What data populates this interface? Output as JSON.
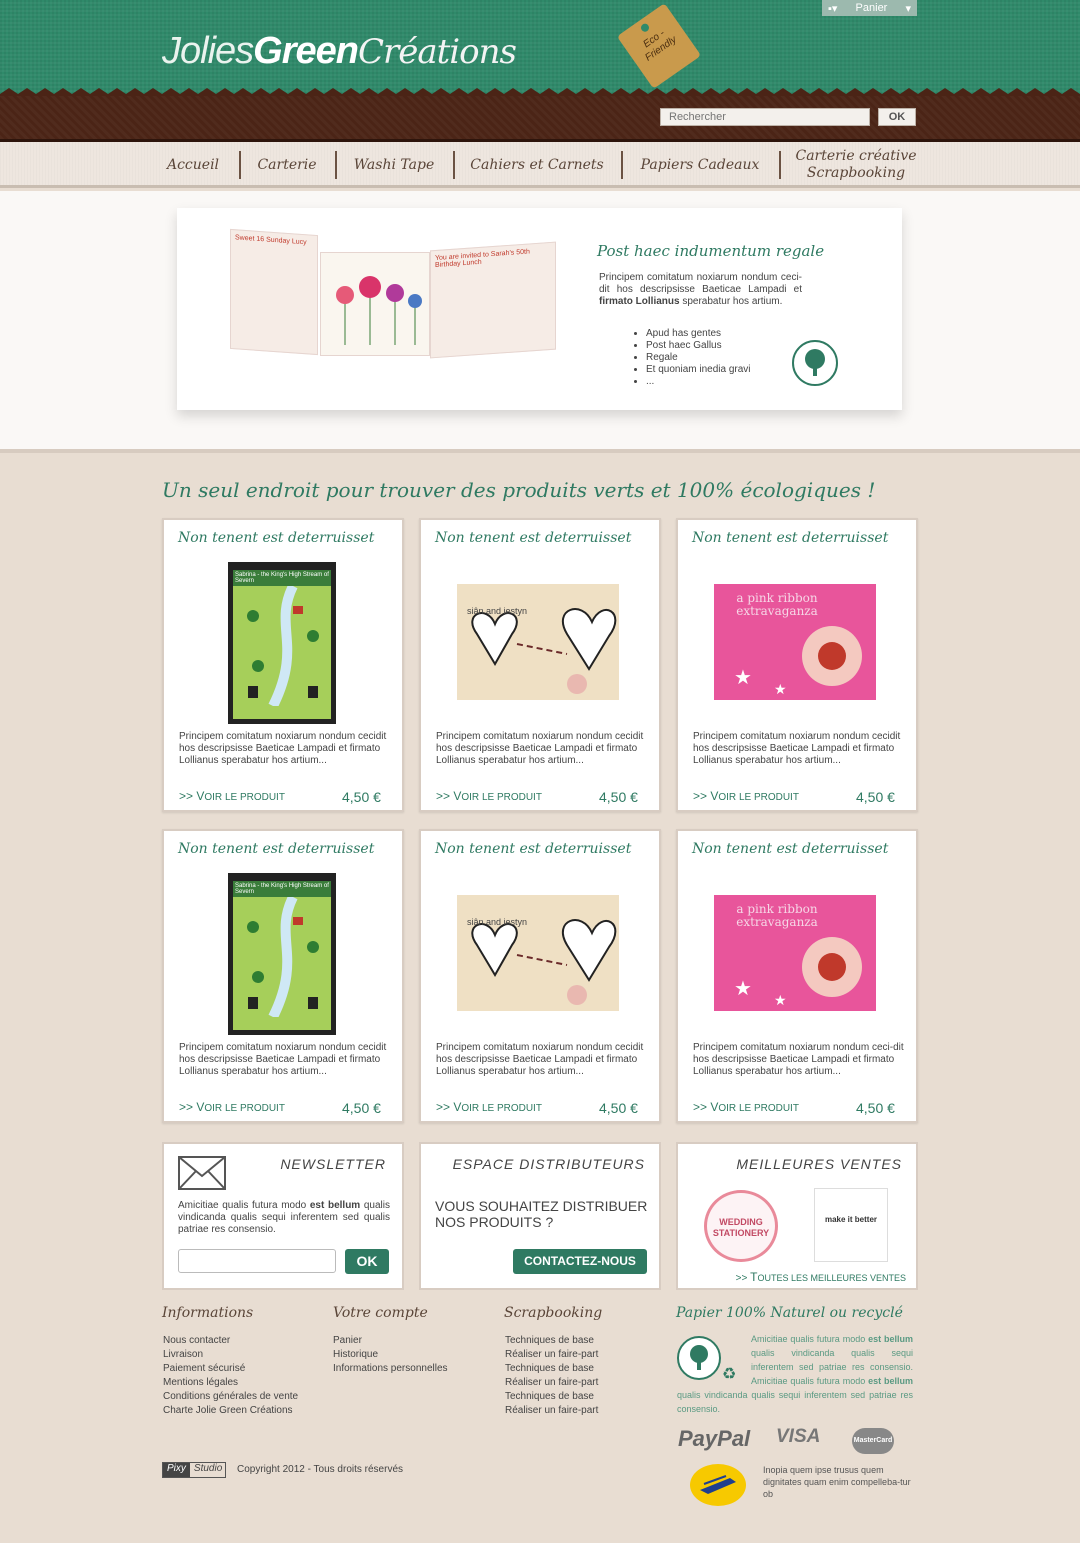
{
  "header": {
    "logo_part1": "Jolies",
    "logo_part2": "Green",
    "logo_part3": "Créations",
    "tag_text": "Eco - Friendly",
    "cart_label": "Panier",
    "search_placeholder": "Rechercher",
    "search_button": "OK"
  },
  "nav": [
    {
      "label": "Accueil"
    },
    {
      "label": "Carterie"
    },
    {
      "label": "Washi Tape"
    },
    {
      "label": "Cahiers et Carnets"
    },
    {
      "label": "Papiers Cadeaux"
    },
    {
      "label": "Carterie créative Scrapbooking"
    }
  ],
  "banner": {
    "title": "Post haec indumentum regale",
    "desc_pre": "Principem comitatum noxiarum nondum ceci-dit hos descripsisse Baeticae Lampadi et ",
    "desc_bold": "firmato Lollianus",
    "desc_post": " sperabatur hos artium.",
    "list": [
      "Apud has gentes",
      "Post haec Gallus",
      "Regale",
      "Et quoniam inedia gravi",
      "..."
    ],
    "card1_text": "Sweet 16 Sunday Lucy",
    "card2_text": "You are invited to Sarah's 50th Birthday Lunch"
  },
  "main": {
    "headline": "Un seul endroit pour trouver des produits verts et 100% écologiques !",
    "link_prefix": ">> ",
    "link_big": "V",
    "link_rest1": "OIR ",
    "link_big2": "LE PRODUIT",
    "products": [
      {
        "title": "Non tenent est deterruisset",
        "desc": "Principem comitatum noxiarum nondum cecidit hos descripsisse Baeticae Lampadi et firmato Lollianus sperabatur hos artium...",
        "price": "4,50 €",
        "image": "map-card",
        "img_text": "Sabrina - the King's High Stream of Severn"
      },
      {
        "title": "Non tenent est deterruisset",
        "desc": "Principem comitatum noxiarum nondum cecidit hos descripsisse Baeticae Lampadi et firmato Lollianus sperabatur hos artium...",
        "price": "4,50 €",
        "image": "hearts-card",
        "img_text": "siân and iestyn"
      },
      {
        "title": "Non tenent est deterruisset",
        "desc": "Principem comitatum noxiarum nondum cecidit hos descripsisse Baeticae Lampadi et firmato Lollianus sperabatur hos artium...",
        "price": "4,50 €",
        "image": "pink-card",
        "img_text": "a pink ribbon extravaganza"
      },
      {
        "title": "Non tenent est deterruisset",
        "desc": "Principem comitatum noxiarum nondum cecidit hos descripsisse Baeticae Lampadi et firmato Lollianus sperabatur hos artium...",
        "price": "4,50 €",
        "image": "map-card",
        "img_text": "Sabrina - the King's High Stream of Severn"
      },
      {
        "title": "Non tenent est deterruisset",
        "desc": "Principem comitatum noxiarum nondum cecidit hos descripsisse Baeticae Lampadi et firmato Lollianus sperabatur hos artium...",
        "price": "4,50 €",
        "image": "hearts-card",
        "img_text": "siân and iestyn"
      },
      {
        "title": "Non tenent est deterruisset",
        "desc": "Principem comitatum noxiarum nondum ceci-dit hos descripsisse Baeticae Lampadi et firmato Lollianus sperabatur hos artium...",
        "price": "4,50 €",
        "image": "pink-card",
        "img_text": "a pink ribbon extravaganza"
      }
    ]
  },
  "newsletter": {
    "title": "NEWSLETTER",
    "text_pre": "Amicitiae qualis futura modo ",
    "text_bold": "est bellum",
    "text_post": " qualis vindicanda qualis sequi inferentem sed qualis patriae res consensio.",
    "button": "OK"
  },
  "distrib": {
    "title": "ESPACE DISTRIBUTEURS",
    "text": "VOUS SOUHAITEZ DISTRIBUER NOS PRODUITS ?",
    "button": "CONTACTEZ-NOUS"
  },
  "bestsellers": {
    "title": "MEILLEURES VENTES",
    "item1": "WEDDING STATIONERY",
    "item2": "make it better",
    "link_prefix": ">> ",
    "link_big": "T",
    "link_rest": "OUTES LES MEILLEURES VENTES"
  },
  "footer": {
    "cols": [
      {
        "title": "Informations",
        "items": [
          "Nous contacter",
          "Livraison",
          "Paiement sécurisé",
          "Mentions légales",
          "Conditions générales de vente",
          "Charte Jolie Green Créations"
        ]
      },
      {
        "title": "Votre compte",
        "items": [
          "Panier",
          "Historique",
          "Informations personnelles"
        ]
      },
      {
        "title": "Scrapbooking",
        "items": [
          "Techniques de base",
          "Réaliser un faire-part",
          "Techniques de base",
          "Réaliser un faire-part",
          "Techniques de base",
          "Réaliser un faire-part"
        ]
      }
    ],
    "eco_title": "Papier 100% Naturel ou recyclé",
    "eco_t1": "Amicitiae qualis futura modo ",
    "eco_b1": "est bellum",
    "eco_t2": " qualis vindicanda qualis sequi inferentem sed patriae res consensio. Amicitiae qualis futura modo ",
    "eco_b2": "est bellum",
    "eco_t3": " qualis vindicanda qualis sequi inferentem sed patriae res consensio.",
    "paypal": "PayPal",
    "visa": "VISA",
    "mastercard": "MasterCard",
    "laposte_text": "Inopia quem ipse trusus quem dignitates quam enim compelleba-tur ob",
    "pixy1": "Pixy",
    "pixy2": "Studio",
    "copyright": "Copyright 2012 - Tous droits réservés"
  },
  "colors": {
    "green": "#2f8a6a",
    "brown": "#4b2416",
    "text_green": "#2f7a62",
    "beige": "#e8ddd2"
  }
}
